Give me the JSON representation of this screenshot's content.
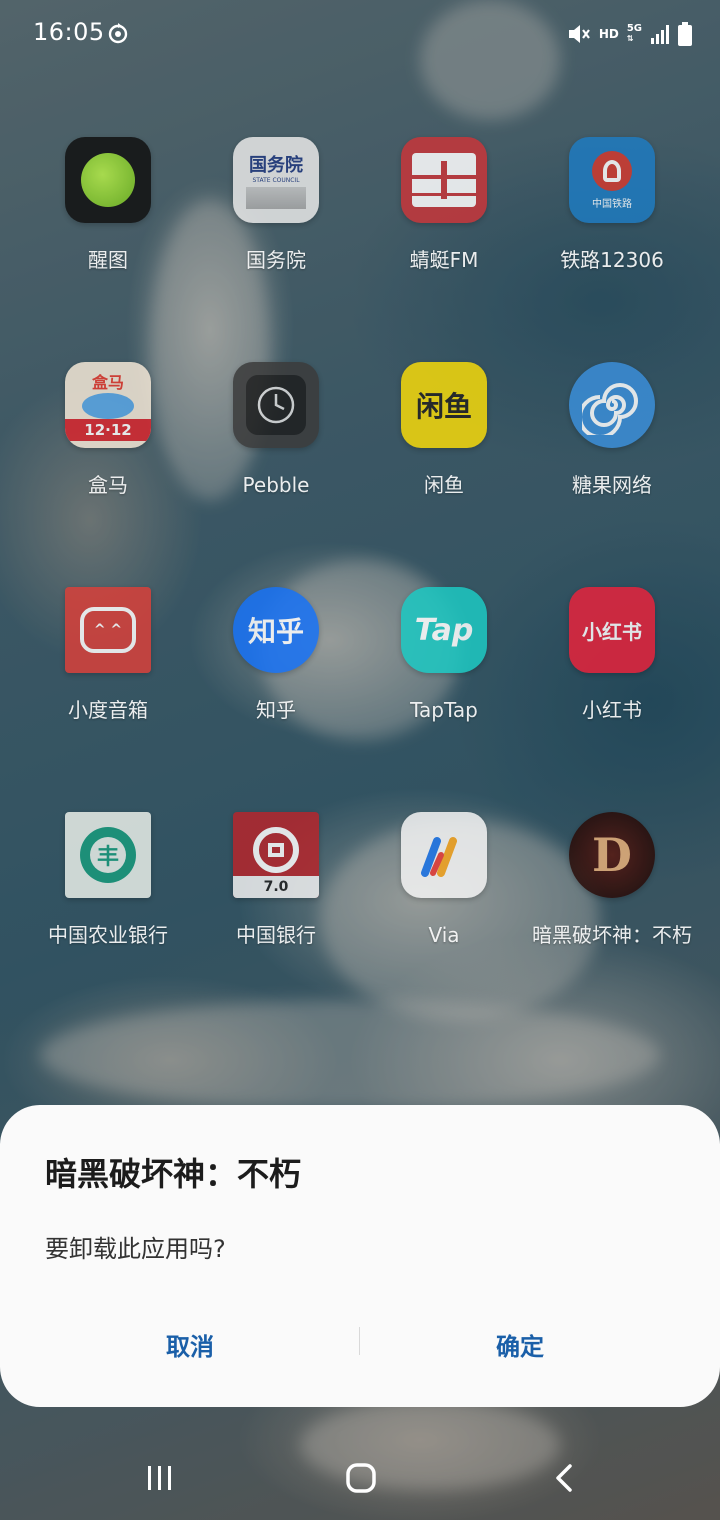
{
  "status_bar": {
    "time": "16:05",
    "hd": "HD",
    "network": "5G",
    "icons": [
      "sync-icon",
      "mute-icon",
      "signal-icon",
      "battery-icon"
    ]
  },
  "apps": [
    {
      "label": "醒图",
      "icon": "xingtu-icon"
    },
    {
      "label": "国务院",
      "icon": "state-council-icon",
      "icon_text": "国务院",
      "icon_sub": "STATE COUNCIL"
    },
    {
      "label": "蜻蜓FM",
      "icon": "qingting-fm-icon"
    },
    {
      "label": "铁路12306",
      "icon": "railway-12306-icon",
      "icon_text": "中国铁路"
    },
    {
      "label": "盒马",
      "icon": "hema-icon",
      "icon_text": "盒马",
      "icon_sub": "12·12"
    },
    {
      "label": "Pebble",
      "icon": "pebble-clock-icon"
    },
    {
      "label": "闲鱼",
      "icon": "xianyu-icon",
      "icon_text": "闲鱼"
    },
    {
      "label": "糖果网络",
      "icon": "candy-network-icon"
    },
    {
      "label": "小度音箱",
      "icon": "xiaodu-icon"
    },
    {
      "label": "知乎",
      "icon": "zhihu-icon",
      "icon_text": "知乎"
    },
    {
      "label": "TapTap",
      "icon": "taptap-icon",
      "icon_text": "Tap"
    },
    {
      "label": "小红书",
      "icon": "xiaohongshu-icon",
      "icon_text": "小红书"
    },
    {
      "label": "中国农业银行",
      "icon": "abc-bank-icon"
    },
    {
      "label": "中国银行",
      "icon": "boc-bank-icon",
      "icon_sub": "7.0"
    },
    {
      "label": "Via",
      "icon": "via-browser-icon"
    },
    {
      "label": "暗黑破坏神：不朽",
      "icon": "diablo-immortal-icon",
      "icon_text": "D"
    }
  ],
  "dialog": {
    "title": "暗黑破坏神：不朽",
    "message": "要卸载此应用吗?",
    "cancel_label": "取消",
    "confirm_label": "确定",
    "accent_color": "#1a5fa8"
  },
  "nav_bar": {
    "buttons": [
      "recent-apps-icon",
      "home-icon",
      "back-icon"
    ]
  }
}
